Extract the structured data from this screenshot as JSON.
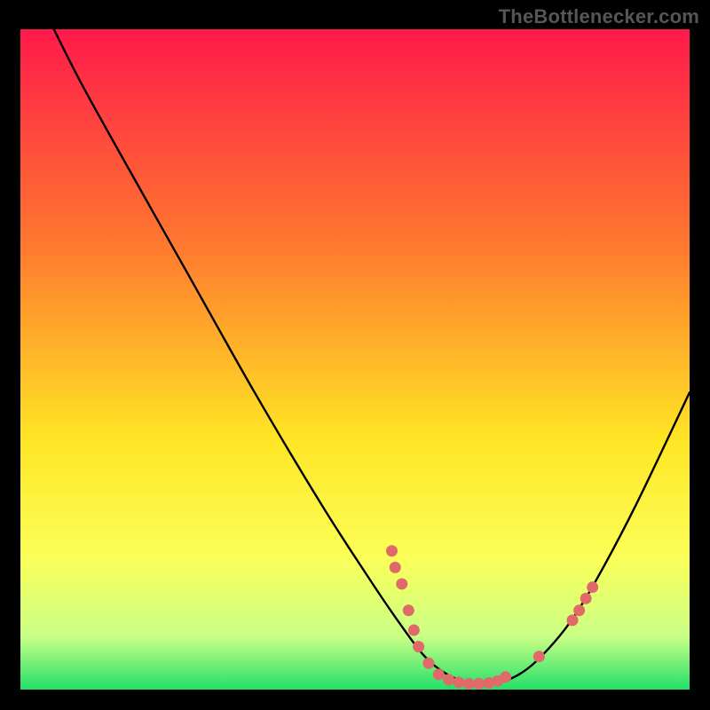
{
  "attribution": "TheBottlenecker.com",
  "chart_data": {
    "type": "line",
    "title": "",
    "xlabel": "",
    "ylabel": "",
    "xlim": [
      0,
      100
    ],
    "ylim": [
      0,
      100
    ],
    "gradient_stops": [
      {
        "offset": 0,
        "color": "#ff1a4b"
      },
      {
        "offset": 0.33,
        "color": "#ff7a2f"
      },
      {
        "offset": 0.62,
        "color": "#ffe524"
      },
      {
        "offset": 0.8,
        "color": "#fbff58"
      },
      {
        "offset": 0.92,
        "color": "#c9ff86"
      },
      {
        "offset": 1.0,
        "color": "#22e06a"
      }
    ],
    "curve": [
      {
        "x": 5.0,
        "y": 100.0
      },
      {
        "x": 9.0,
        "y": 92.0
      },
      {
        "x": 15.0,
        "y": 81.0
      },
      {
        "x": 25.0,
        "y": 63.0
      },
      {
        "x": 35.0,
        "y": 45.0
      },
      {
        "x": 45.0,
        "y": 28.0
      },
      {
        "x": 52.0,
        "y": 17.0
      },
      {
        "x": 56.0,
        "y": 11.0
      },
      {
        "x": 60.0,
        "y": 5.5
      },
      {
        "x": 63.0,
        "y": 2.8
      },
      {
        "x": 66.0,
        "y": 1.3
      },
      {
        "x": 69.0,
        "y": 0.9
      },
      {
        "x": 72.0,
        "y": 1.2
      },
      {
        "x": 75.0,
        "y": 2.6
      },
      {
        "x": 78.0,
        "y": 5.2
      },
      {
        "x": 82.0,
        "y": 10.0
      },
      {
        "x": 86.0,
        "y": 16.5
      },
      {
        "x": 92.0,
        "y": 28.0
      },
      {
        "x": 100.0,
        "y": 45.0
      }
    ],
    "markers": [
      {
        "x": 55.5,
        "y": 21.0
      },
      {
        "x": 56.0,
        "y": 18.5
      },
      {
        "x": 57.0,
        "y": 16.0
      },
      {
        "x": 58.0,
        "y": 12.0
      },
      {
        "x": 58.8,
        "y": 9.0
      },
      {
        "x": 59.5,
        "y": 6.5
      },
      {
        "x": 61.0,
        "y": 4.0
      },
      {
        "x": 62.5,
        "y": 2.3
      },
      {
        "x": 64.0,
        "y": 1.5
      },
      {
        "x": 65.5,
        "y": 1.1
      },
      {
        "x": 67.0,
        "y": 0.9
      },
      {
        "x": 68.5,
        "y": 0.9
      },
      {
        "x": 70.0,
        "y": 1.0
      },
      {
        "x": 71.3,
        "y": 1.3
      },
      {
        "x": 72.5,
        "y": 1.9
      },
      {
        "x": 77.5,
        "y": 5.0
      },
      {
        "x": 82.5,
        "y": 10.5
      },
      {
        "x": 83.5,
        "y": 12.0
      },
      {
        "x": 84.5,
        "y": 13.8
      },
      {
        "x": 85.5,
        "y": 15.5
      }
    ],
    "marker_color": "#e06a6a",
    "curve_color": "#000000"
  }
}
